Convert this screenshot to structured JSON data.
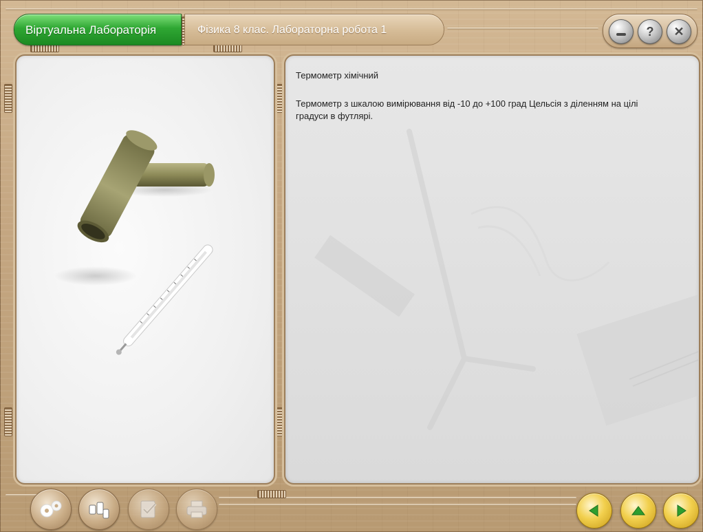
{
  "header": {
    "app_tab_label": "Віртуальна Лабораторія",
    "lesson_title": "Фізика 8 клас. Лабораторна робота 1"
  },
  "window_controls": {
    "minimize_icon": "minimize-icon",
    "help_icon": "question-icon",
    "close_icon": "close-icon"
  },
  "item": {
    "name": "Термометр хімічний",
    "description": "Термометр з шкалою вимірювання від -10 до +100 град Цельсія з діленням на цілі градуси в футлярі."
  },
  "toolbar": {
    "tools": [
      {
        "icon": "gears-icon",
        "enabled": true
      },
      {
        "icon": "weights-icon",
        "enabled": true
      },
      {
        "icon": "checklist-icon",
        "enabled": false
      },
      {
        "icon": "printer-icon",
        "enabled": false
      }
    ]
  },
  "navigation": {
    "back_icon": "arrow-left-icon",
    "up_icon": "arrow-up-icon",
    "forward_icon": "arrow-right-icon"
  },
  "colors": {
    "active_tab": "#2fa733",
    "frame_wood": "#c5a782",
    "nav_button": "#f2d04e",
    "nav_arrow": "#2f9e2f"
  }
}
